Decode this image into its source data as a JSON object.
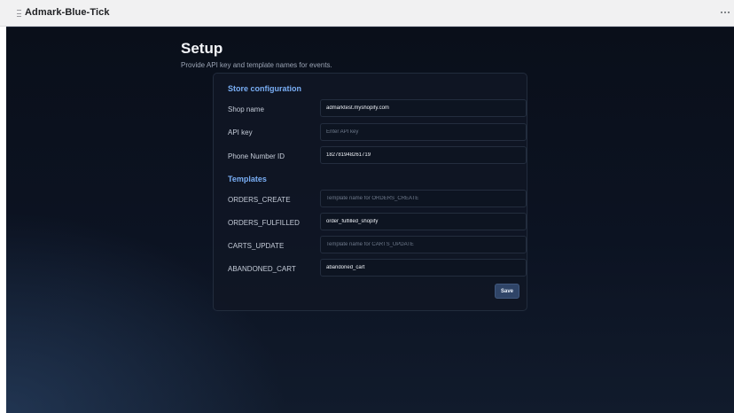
{
  "window": {
    "title": "Admark-Blue-Tick",
    "app_icon": "grid-icon",
    "menu_icon": "more-horizontal-icon"
  },
  "page": {
    "title": "Setup",
    "subtitle": "Provide API key and template names for events."
  },
  "store_configuration": {
    "heading": "Store configuration",
    "fields": [
      {
        "label": "Shop name",
        "value": "admarktest.myshopify.com",
        "placeholder": ""
      },
      {
        "label": "API key",
        "value": "",
        "placeholder": "Enter API key"
      },
      {
        "label": "Phone Number ID",
        "value": "182781948261719",
        "placeholder": ""
      }
    ]
  },
  "templates": {
    "heading": "Templates",
    "fields": [
      {
        "label": "ORDERS_CREATE",
        "value": "",
        "placeholder": "Template name for ORDERS_CREATE"
      },
      {
        "label": "ORDERS_FULFILLED",
        "value": "order_fulfilled_shopify",
        "placeholder": ""
      },
      {
        "label": "CARTS_UPDATE",
        "value": "",
        "placeholder": "Template name for CARTS_UPDATE"
      },
      {
        "label": "ABANDONED_CART",
        "value": "abandoned_cart",
        "placeholder": ""
      }
    ]
  },
  "actions": {
    "save_label": "Save"
  },
  "colors": {
    "background": "#0b1120",
    "card": "#101624",
    "accent_heading": "#79aef5",
    "button": "#2f4467"
  }
}
